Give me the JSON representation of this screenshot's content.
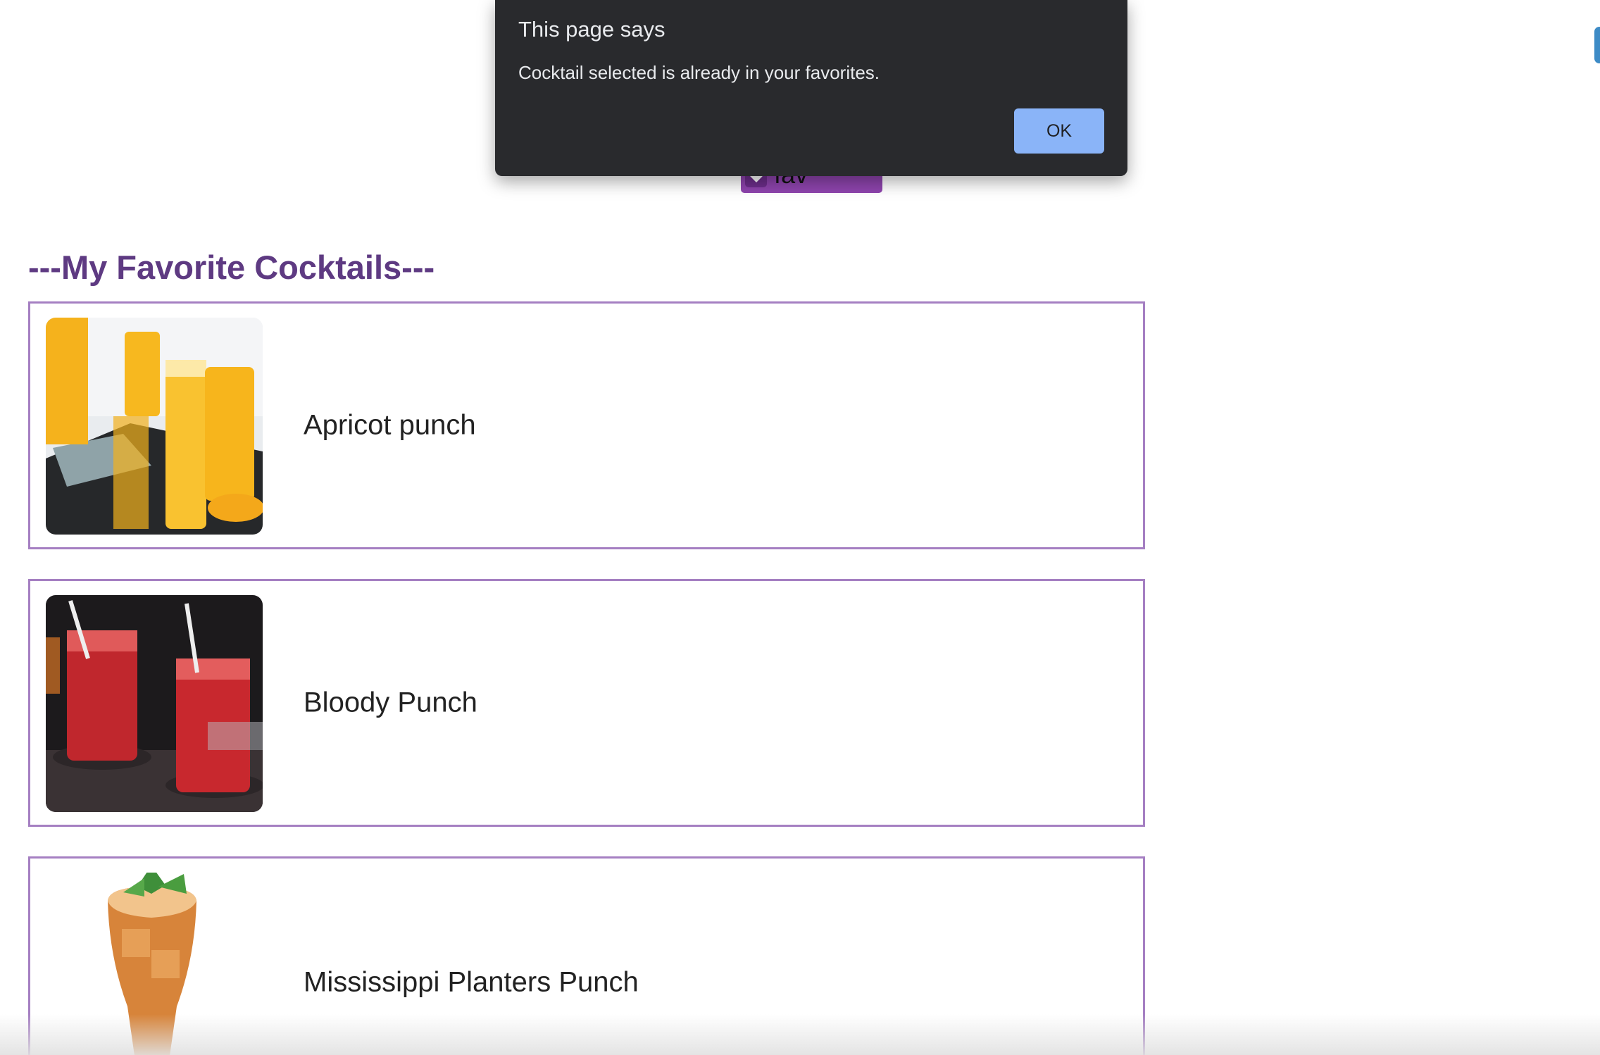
{
  "page": {
    "favorites_heading": "---My Favorite Cocktails---",
    "add_button_label": "add to fav",
    "add_button_icon": "heart-icon"
  },
  "favorites": [
    {
      "name": "Apricot punch",
      "image": "apricot-punch-photo"
    },
    {
      "name": "Bloody Punch",
      "image": "bloody-punch-photo"
    },
    {
      "name": "Mississippi Planters Punch",
      "image": "mississippi-planters-punch-photo"
    }
  ],
  "dialog": {
    "title": "This page says",
    "message": "Cocktail selected is already in your favorites.",
    "ok_label": "OK"
  },
  "colors": {
    "accent_purple": "#8e44ad",
    "heading_purple": "#5e3a82",
    "card_border": "#a57fc2",
    "dialog_bg": "#292a2d",
    "ok_button": "#8ab4f8"
  }
}
